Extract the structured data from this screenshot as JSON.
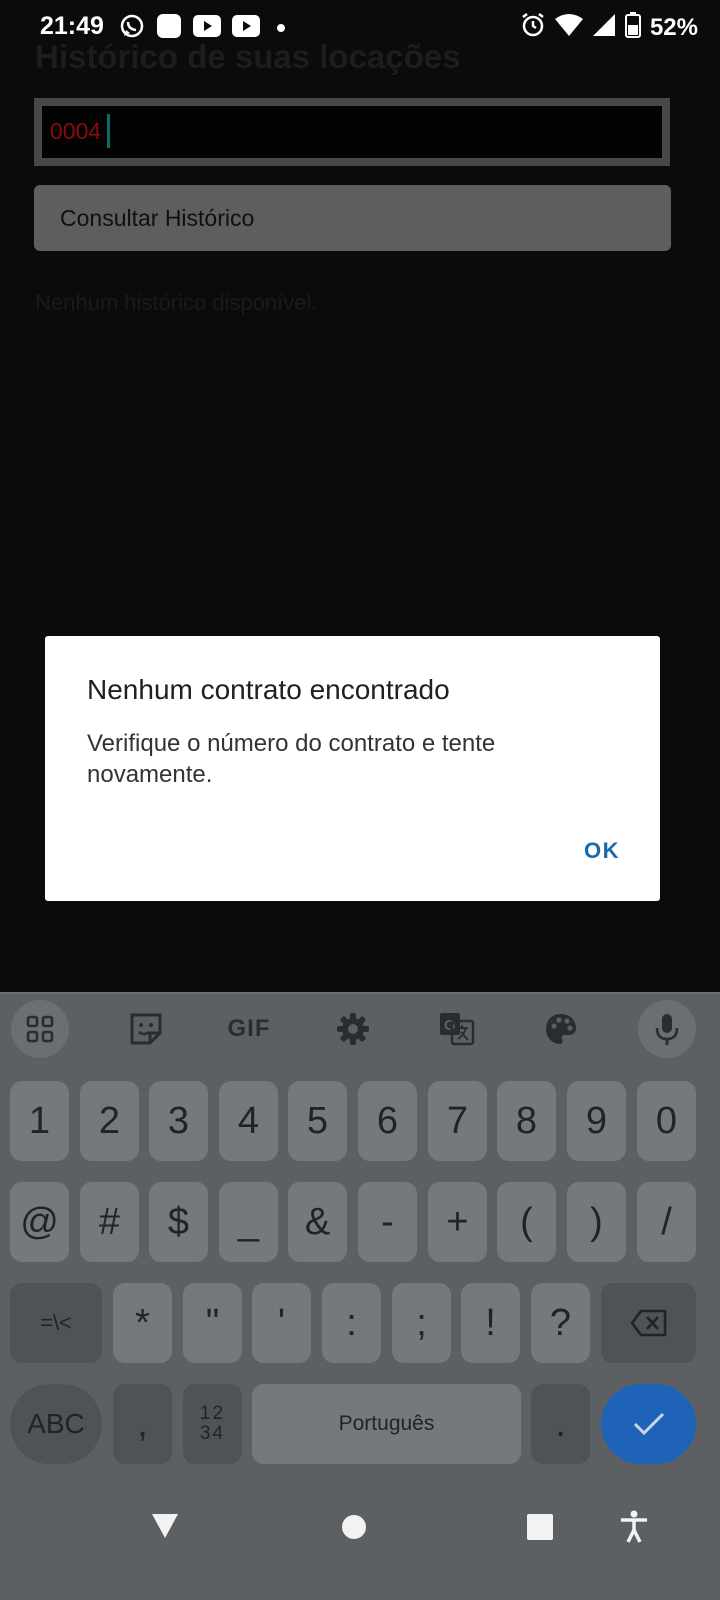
{
  "status_bar": {
    "time": "21:49",
    "notification_icons": [
      "whatsapp-icon",
      "app-icon",
      "youtube-icon",
      "youtube-icon",
      "dot-icon"
    ],
    "system_icons": [
      "alarm-icon",
      "wifi-icon",
      "signal-icon",
      "battery-icon"
    ],
    "battery": "52%"
  },
  "page": {
    "title": "Histórico de suas locações",
    "contract_input_value": "0004",
    "consult_button": "Consultar Histórico",
    "empty_message": "Nenhum histórico disponível."
  },
  "dialog": {
    "title": "Nenhum contrato encontrado",
    "message": "Verifique o número do contrato e tente novamente.",
    "ok_button": "OK"
  },
  "keyboard": {
    "toolbar": [
      "apps-icon",
      "sticker-icon",
      "gif-icon",
      "settings-icon",
      "translate-icon",
      "palette-icon",
      "mic-icon"
    ],
    "toolbar_gif_label": "GIF",
    "row1": [
      "1",
      "2",
      "3",
      "4",
      "5",
      "6",
      "7",
      "8",
      "9",
      "0"
    ],
    "row2": [
      "@",
      "#",
      "$",
      "_",
      "&",
      "-",
      "+",
      "(",
      ")",
      "/"
    ],
    "row3_shift": "=\\<",
    "row3": [
      "*",
      "\"",
      "'",
      ":",
      ";",
      "!",
      "?"
    ],
    "abc_key": "ABC",
    "comma_key": ",",
    "numpad_key_top": "12",
    "numpad_key_bottom": "34",
    "space_label": "Português",
    "period_key": "."
  },
  "nav_bar": {
    "buttons": [
      "back-icon",
      "home-icon",
      "recents-icon",
      "accessibility-icon"
    ]
  },
  "colors": {
    "accent": "#1a6aaa",
    "enter_key": "#1e63b7",
    "input_text": "#8a0b0b"
  }
}
